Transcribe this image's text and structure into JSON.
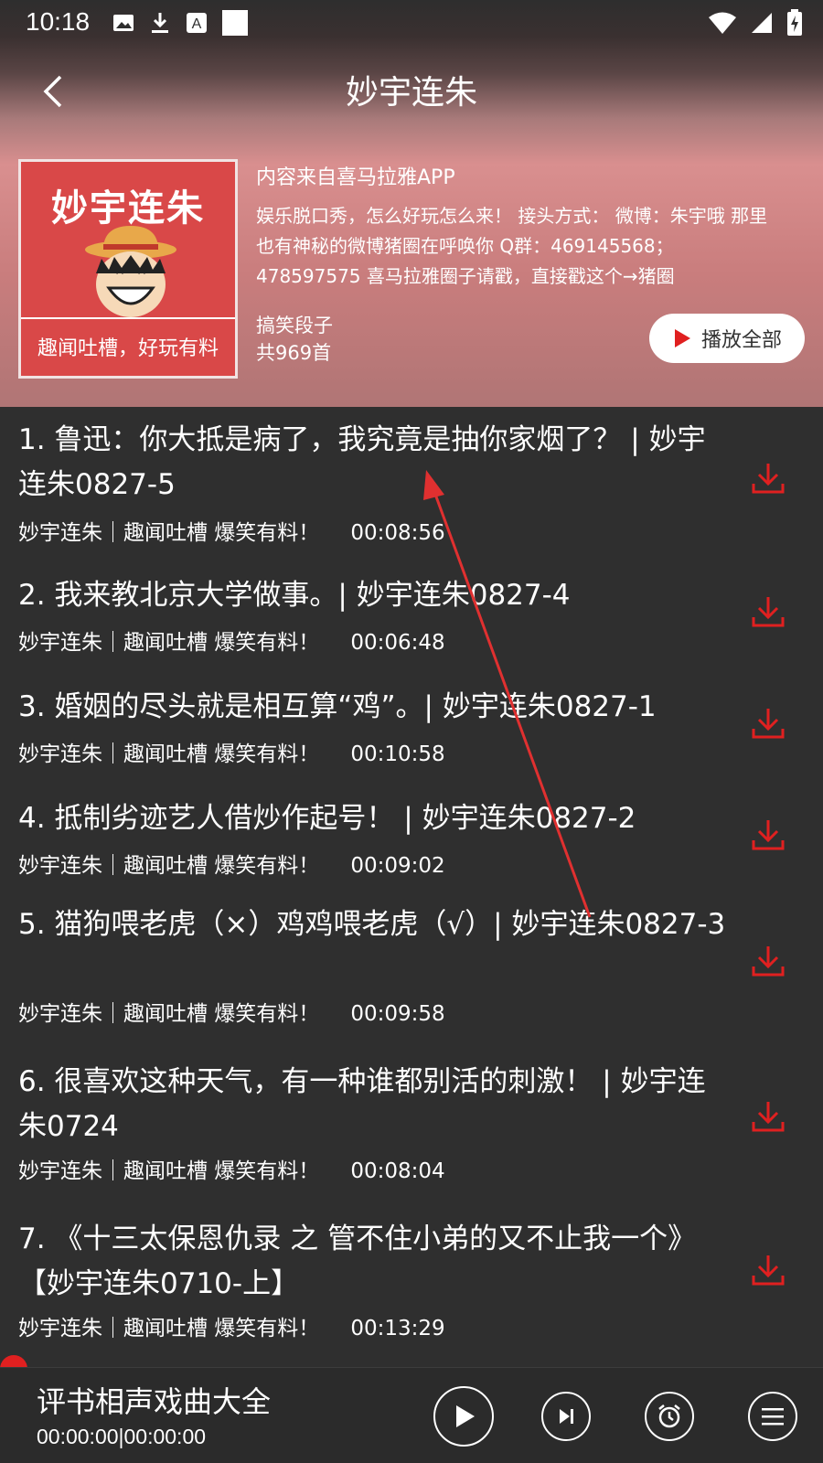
{
  "status_bar": {
    "time": "10:18",
    "icons": [
      "image-icon",
      "download-icon",
      "text-icon",
      "blank-icon",
      "wifi-icon",
      "signal-icon",
      "battery-icon"
    ]
  },
  "header": {
    "title": "妙宇连朱"
  },
  "album": {
    "cover_title": "妙宇连朱",
    "cover_subtitle": "趣闻吐槽，好玩有料",
    "source": "内容来自喜马拉雅APP",
    "description": "娱乐脱口秀，怎么好玩怎么来！ 接头方式：  微博：朱宇哦  那里也有神秘的微博猪圈在呼唤你 Q群：469145568；478597575  喜马拉雅圈子请戳，直接戳这个→猪圈",
    "category": "搞笑段子",
    "count": "共969首",
    "play_all_label": "播放全部"
  },
  "tracks": [
    {
      "title": "1. 鲁迅：你大抵是病了，我究竟是抽你家烟了？ | 妙宇连朱0827-5",
      "meta": "妙宇连朱｜趣闻吐槽 爆笑有料！",
      "duration": "00:08:56"
    },
    {
      "title": "2. 我来教北京大学做事。| 妙宇连朱0827-4",
      "meta": "妙宇连朱｜趣闻吐槽 爆笑有料！",
      "duration": "00:06:48"
    },
    {
      "title": "3. 婚姻的尽头就是相互算“鸡”。| 妙宇连朱0827-1",
      "meta": "妙宇连朱｜趣闻吐槽 爆笑有料！",
      "duration": "00:10:58"
    },
    {
      "title": "4. 抵制劣迹艺人借炒作起号！ | 妙宇连朱0827-2",
      "meta": "妙宇连朱｜趣闻吐槽 爆笑有料！",
      "duration": "00:09:02"
    },
    {
      "title": "5. 猫狗喂老虎（×）鸡鸡喂老虎（√）| 妙宇连朱0827-3",
      "meta": "妙宇连朱｜趣闻吐槽 爆笑有料！",
      "duration": "00:09:58"
    },
    {
      "title": "6. 很喜欢这种天气，有一种谁都别活的刺激！ | 妙宇连朱0724",
      "meta": "妙宇连朱｜趣闻吐槽 爆笑有料！",
      "duration": "00:08:04"
    },
    {
      "title": "7. 《十三太保恩仇录 之 管不住小弟的又不止我一个》【妙宇连朱0710-上】",
      "meta": "妙宇连朱｜趣闻吐槽 爆笑有料！",
      "duration": "00:13:29"
    }
  ],
  "player": {
    "title": "评书相声戏曲大全",
    "time": "00:00:00|00:00:00"
  },
  "colors": {
    "accent": "#e02020",
    "background": "#2f2f2f"
  }
}
